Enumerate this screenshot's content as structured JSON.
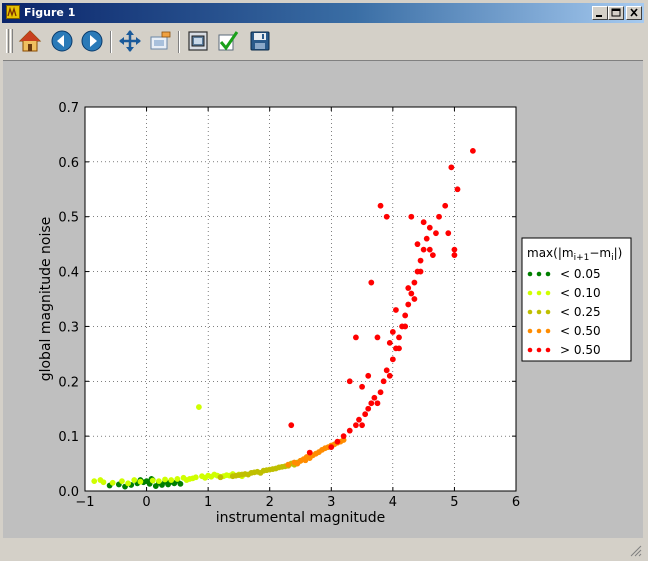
{
  "window": {
    "title": "Figure 1",
    "controls": {
      "minimize": "minimize-icon",
      "maximize": "maximize-icon",
      "close": "close-icon"
    }
  },
  "toolbar": {
    "buttons": [
      {
        "name": "home-button",
        "icon": "home-icon"
      },
      {
        "name": "back-button",
        "icon": "back-arrow-icon"
      },
      {
        "name": "forward-button",
        "icon": "forward-arrow-icon"
      },
      {
        "name": "pan-button",
        "icon": "pan-arrows-icon"
      },
      {
        "name": "zoom-button",
        "icon": "zoom-rect-icon"
      },
      {
        "name": "subplots-button",
        "icon": "subplots-icon"
      },
      {
        "name": "edit-button",
        "icon": "checkmark-icon"
      },
      {
        "name": "save-button",
        "icon": "floppy-disk-icon"
      }
    ]
  },
  "colors": {
    "lt005": "#007f00",
    "lt010": "#cfff00",
    "lt025": "#bfbf00",
    "lt050": "#ff8c00",
    "gt050": "#ff0000"
  },
  "chart_data": {
    "type": "scatter",
    "xlabel": "instrumental magnitude",
    "ylabel": "global magnitude noise",
    "xlim": [
      -1,
      6
    ],
    "ylim": [
      0.0,
      0.7
    ],
    "xticks": [
      "−1",
      "0",
      "1",
      "2",
      "3",
      "4",
      "5",
      "6"
    ],
    "yticks": [
      "0.0",
      "0.1",
      "0.2",
      "0.3",
      "0.4",
      "0.5",
      "0.6",
      "0.7"
    ],
    "grid": true,
    "legend": {
      "title_prefix": "max(|m",
      "title_sub1": "i+1",
      "title_mid": "−m",
      "title_sub2": "i",
      "title_suffix": "|)",
      "placement": "right outside",
      "entries": [
        "< 0.05",
        "< 0.10",
        "< 0.25",
        "< 0.50",
        "> 0.50"
      ]
    },
    "series": [
      {
        "name": "< 0.05",
        "color": "#007f00",
        "points": [
          [
            -0.6,
            0.01
          ],
          [
            -0.45,
            0.012
          ],
          [
            -0.35,
            0.008
          ],
          [
            -0.25,
            0.011
          ],
          [
            -0.15,
            0.014
          ],
          [
            -0.05,
            0.016
          ],
          [
            0.0,
            0.018
          ],
          [
            0.05,
            0.013
          ],
          [
            0.1,
            0.02
          ],
          [
            0.15,
            0.009
          ],
          [
            0.2,
            0.015
          ],
          [
            0.25,
            0.011
          ],
          [
            0.3,
            0.017
          ],
          [
            0.35,
            0.012
          ],
          [
            0.45,
            0.014
          ],
          [
            0.5,
            0.019
          ],
          [
            0.55,
            0.013
          ],
          [
            -0.1,
            0.02
          ],
          [
            0.08,
            0.022
          ],
          [
            0.38,
            0.016
          ]
        ]
      },
      {
        "name": "< 0.10",
        "color": "#cfff00",
        "points": [
          [
            -0.85,
            0.018
          ],
          [
            -0.75,
            0.02
          ],
          [
            -0.7,
            0.016
          ],
          [
            -0.55,
            0.015
          ],
          [
            -0.4,
            0.018
          ],
          [
            -0.3,
            0.014
          ],
          [
            -0.2,
            0.02
          ],
          [
            -0.1,
            0.017
          ],
          [
            0.1,
            0.019
          ],
          [
            0.2,
            0.018
          ],
          [
            0.3,
            0.021
          ],
          [
            0.4,
            0.02
          ],
          [
            0.5,
            0.022
          ],
          [
            0.6,
            0.024
          ],
          [
            0.7,
            0.022
          ],
          [
            0.8,
            0.025
          ],
          [
            0.85,
            0.153
          ],
          [
            0.9,
            0.027
          ],
          [
            1.0,
            0.028
          ],
          [
            1.1,
            0.03
          ],
          [
            1.2,
            0.026
          ],
          [
            1.3,
            0.029
          ],
          [
            1.4,
            0.031
          ],
          [
            1.5,
            0.03
          ],
          [
            1.55,
            0.027
          ],
          [
            0.65,
            0.02
          ],
          [
            0.75,
            0.023
          ],
          [
            0.95,
            0.024
          ],
          [
            1.05,
            0.026
          ],
          [
            1.15,
            0.028
          ],
          [
            1.25,
            0.027
          ],
          [
            1.35,
            0.028
          ]
        ]
      },
      {
        "name": "< 0.25",
        "color": "#bfbf00",
        "points": [
          [
            1.2,
            0.025
          ],
          [
            1.4,
            0.027
          ],
          [
            1.5,
            0.029
          ],
          [
            1.6,
            0.031
          ],
          [
            1.7,
            0.033
          ],
          [
            1.8,
            0.035
          ],
          [
            1.9,
            0.037
          ],
          [
            2.0,
            0.039
          ],
          [
            2.1,
            0.041
          ],
          [
            2.2,
            0.044
          ],
          [
            2.3,
            0.046
          ],
          [
            2.35,
            0.05
          ],
          [
            2.4,
            0.048
          ],
          [
            2.45,
            0.052
          ],
          [
            1.65,
            0.03
          ],
          [
            1.75,
            0.034
          ],
          [
            1.85,
            0.033
          ],
          [
            1.95,
            0.038
          ],
          [
            2.05,
            0.04
          ],
          [
            2.15,
            0.043
          ],
          [
            2.25,
            0.045
          ],
          [
            1.55,
            0.03
          ],
          [
            1.45,
            0.028
          ],
          [
            2.5,
            0.055
          ]
        ]
      },
      {
        "name": "< 0.50",
        "color": "#ff8c00",
        "points": [
          [
            2.3,
            0.048
          ],
          [
            2.4,
            0.052
          ],
          [
            2.5,
            0.055
          ],
          [
            2.55,
            0.058
          ],
          [
            2.6,
            0.062
          ],
          [
            2.7,
            0.065
          ],
          [
            2.75,
            0.068
          ],
          [
            2.8,
            0.071
          ],
          [
            2.85,
            0.075
          ],
          [
            2.9,
            0.078
          ],
          [
            3.0,
            0.083
          ],
          [
            3.1,
            0.088
          ],
          [
            3.2,
            0.093
          ],
          [
            2.65,
            0.06
          ],
          [
            2.95,
            0.08
          ],
          [
            3.05,
            0.085
          ],
          [
            2.45,
            0.05
          ],
          [
            2.58,
            0.056
          ],
          [
            3.15,
            0.09
          ]
        ]
      },
      {
        "name": "> 0.50",
        "color": "#ff0000",
        "points": [
          [
            2.35,
            0.12
          ],
          [
            2.65,
            0.07
          ],
          [
            3.0,
            0.08
          ],
          [
            3.1,
            0.09
          ],
          [
            3.2,
            0.1
          ],
          [
            3.3,
            0.11
          ],
          [
            3.4,
            0.12
          ],
          [
            3.45,
            0.13
          ],
          [
            3.5,
            0.12
          ],
          [
            3.55,
            0.14
          ],
          [
            3.6,
            0.15
          ],
          [
            3.65,
            0.16
          ],
          [
            3.7,
            0.17
          ],
          [
            3.75,
            0.16
          ],
          [
            3.8,
            0.18
          ],
          [
            3.85,
            0.2
          ],
          [
            3.9,
            0.22
          ],
          [
            3.95,
            0.21
          ],
          [
            4.0,
            0.24
          ],
          [
            4.05,
            0.26
          ],
          [
            4.1,
            0.28
          ],
          [
            4.15,
            0.3
          ],
          [
            4.2,
            0.32
          ],
          [
            4.25,
            0.34
          ],
          [
            4.3,
            0.36
          ],
          [
            4.35,
            0.38
          ],
          [
            4.4,
            0.4
          ],
          [
            4.45,
            0.42
          ],
          [
            4.5,
            0.44
          ],
          [
            4.55,
            0.46
          ],
          [
            4.6,
            0.48
          ],
          [
            3.4,
            0.28
          ],
          [
            3.6,
            0.21
          ],
          [
            3.65,
            0.38
          ],
          [
            3.8,
            0.52
          ],
          [
            3.9,
            0.5
          ],
          [
            3.75,
            0.28
          ],
          [
            4.0,
            0.29
          ],
          [
            4.3,
            0.5
          ],
          [
            4.5,
            0.49
          ],
          [
            4.7,
            0.47
          ],
          [
            4.75,
            0.5
          ],
          [
            4.95,
            0.59
          ],
          [
            5.05,
            0.55
          ],
          [
            5.3,
            0.62
          ],
          [
            5.0,
            0.43
          ],
          [
            4.1,
            0.26
          ],
          [
            4.2,
            0.3
          ],
          [
            4.35,
            0.35
          ],
          [
            4.45,
            0.4
          ],
          [
            3.3,
            0.2
          ],
          [
            3.5,
            0.19
          ],
          [
            3.95,
            0.27
          ],
          [
            4.05,
            0.33
          ],
          [
            4.25,
            0.37
          ],
          [
            4.4,
            0.45
          ],
          [
            4.6,
            0.44
          ],
          [
            4.65,
            0.43
          ],
          [
            4.85,
            0.52
          ],
          [
            4.9,
            0.47
          ],
          [
            5.0,
            0.44
          ]
        ]
      }
    ]
  }
}
